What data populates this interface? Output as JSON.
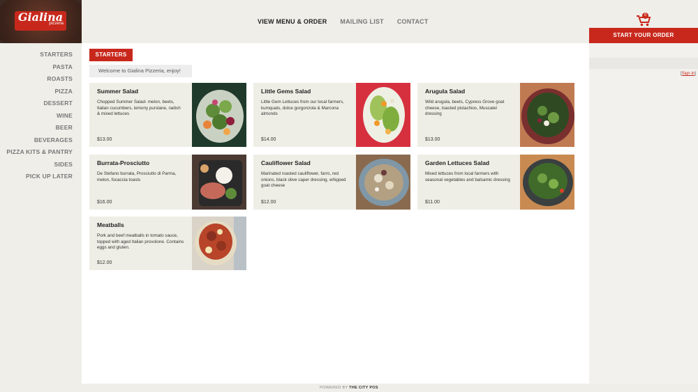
{
  "brand": {
    "name": "Gialina",
    "sub": "pizzeria"
  },
  "topnav": [
    {
      "label": "VIEW MENU & ORDER"
    },
    {
      "label": "MAILING LIST"
    },
    {
      "label": "CONTACT"
    }
  ],
  "cart": {
    "count": "0",
    "start_label": "START YOUR ORDER",
    "signin_label": "Sign In"
  },
  "sidebar": {
    "items": [
      {
        "label": "STARTERS"
      },
      {
        "label": "PASTA"
      },
      {
        "label": "ROASTS"
      },
      {
        "label": "PIZZA"
      },
      {
        "label": "DESSERT"
      },
      {
        "label": "WINE"
      },
      {
        "label": "BEER"
      },
      {
        "label": "BEVERAGES"
      },
      {
        "label": "PIZZA KITS & PANTRY"
      },
      {
        "label": "SIDES"
      },
      {
        "label": "PICK UP LATER"
      }
    ]
  },
  "section": {
    "tab_label": "STARTERS",
    "welcome": "Welcome to Gialina Pizzeria, enjoy!"
  },
  "menu_items": [
    {
      "title": "Summer Salad",
      "desc": "Chopped Summer Salad- melon, beets, Italian cucumbers, lemony purslane, radish & mixed lettuces",
      "price": "$13.00",
      "image": "salad-photo"
    },
    {
      "title": "Little Gems Salad",
      "desc": "Little Gem Lettuces from our local farmers, kumquats, dolce gorgonzola & Marcona almonds",
      "price": "$14.00",
      "image": "salad-photo"
    },
    {
      "title": "Arugula Salad",
      "desc": "Wild arugula, beets, Cypress Grove goat cheese, toasted pistachios, Muscatel dressing",
      "price": "$13.00",
      "image": "salad-bowl-photo"
    },
    {
      "title": "Burrata-Prosciutto",
      "desc": "De Stefano burrata, Prosciutto di Parma, melon, focaccia toasts",
      "price": "$16.00",
      "image": "burrata-photo"
    },
    {
      "title": "Cauliflower Salad",
      "desc": "Marinated roasted cauliflower, farro, red onions, black olive caper dressing, whipped goat cheese",
      "price": "$12.00",
      "image": "cauliflower-photo"
    },
    {
      "title": "Garden Lettuces Salad",
      "desc": "Mixed lettuces from local farmers with seasonal vegetables and balsamic dressing",
      "price": "$11.00",
      "image": "salad-bowl-photo"
    },
    {
      "title": "Meatballs",
      "desc": "Pork and beef meatballs in tomato sauce, topped with aged Italian provolone. Contains eggs and gluten.",
      "price": "$12.00",
      "image": "meatballs-photo"
    }
  ],
  "footer": {
    "powered": "POWERED BY",
    "brand": "THE CITY POS"
  },
  "colors": {
    "accent": "#c8281c",
    "card_bg": "#efeee6",
    "page_bg": "#efeee9"
  }
}
